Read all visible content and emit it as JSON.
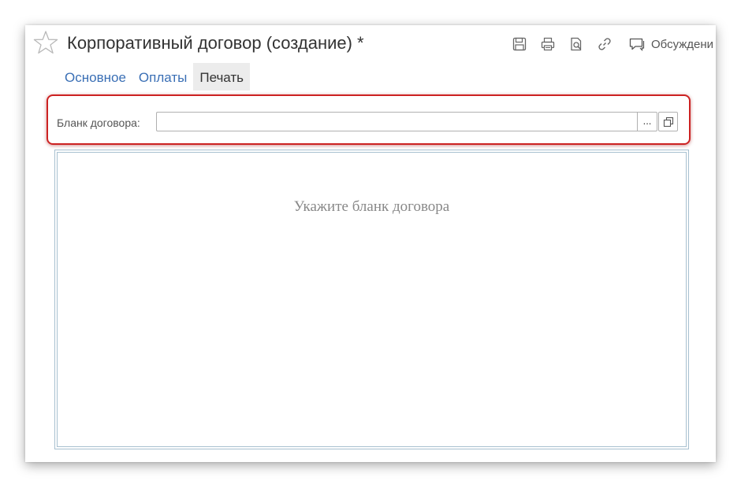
{
  "window": {
    "title": "Корпоративный договор (создание) *"
  },
  "toolbar": {
    "save_icon": "save-icon",
    "print_icon": "print-icon",
    "preview_icon": "print-preview-icon",
    "link_icon": "link-icon",
    "discussion_icon": "discussion-icon",
    "discussion_label": "Обсуждени"
  },
  "tabs": [
    {
      "label": "Основное",
      "active": false
    },
    {
      "label": "Оплаты",
      "active": false
    },
    {
      "label": "Печать",
      "active": true
    }
  ],
  "form": {
    "blank_label": "Бланк договора:",
    "blank_value": "",
    "select_button_label": "...",
    "open_button_icon": "open-icon"
  },
  "preview": {
    "placeholder": "Укажите бланк договора"
  },
  "colors": {
    "tab_link": "#3a6fb5",
    "highlight": "#cc2222",
    "preview_border": "#a8c0d0"
  }
}
